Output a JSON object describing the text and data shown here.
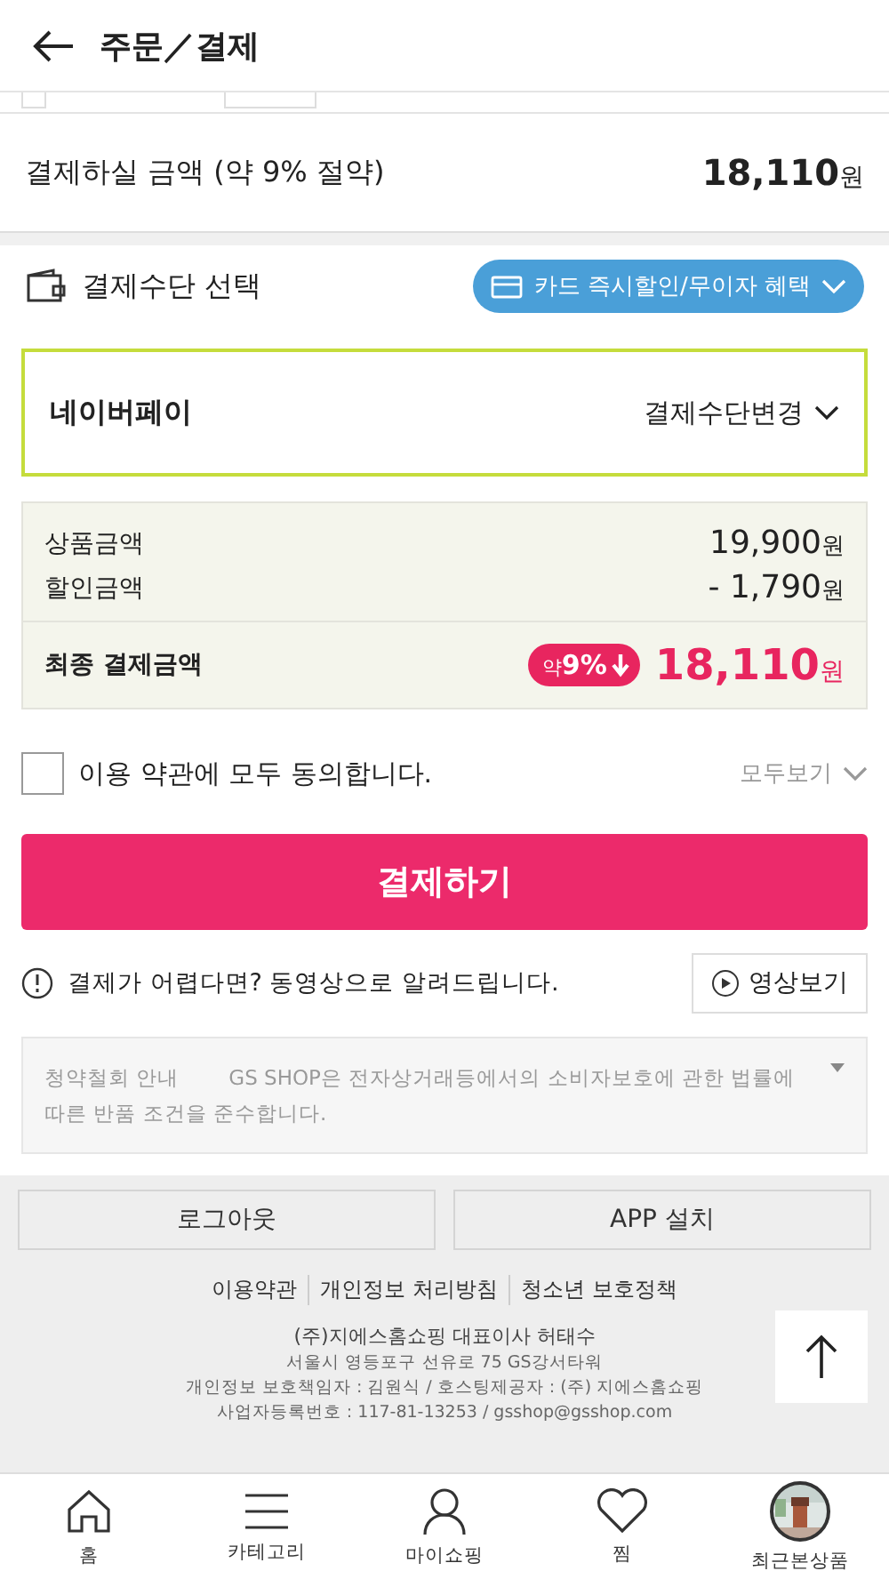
{
  "header": {
    "title": "주문／결제"
  },
  "payment_total": {
    "label": "결제하실 금액 (약 9% 절약)",
    "amount": "18,110",
    "unit": "원"
  },
  "payment_method": {
    "label": "결제수단 선택",
    "benefit_button": "카드 즉시할인/무이자 혜택",
    "selected_method": "네이버페이",
    "change_button": "결제수단변경"
  },
  "summary": {
    "rows": [
      {
        "label": "상품금액",
        "amount": "19,900",
        "unit": "원"
      },
      {
        "label": "할인금액",
        "amount": "- 1,790",
        "unit": "원"
      }
    ],
    "final": {
      "label": "최종 결제금액",
      "badge_prefix": "약",
      "badge_value": "9%",
      "amount": "18,110",
      "unit": "원"
    }
  },
  "agreement": {
    "label": "이용 약관에 모두 동의합니다.",
    "checked": false,
    "view_all": "모두보기"
  },
  "pay_button": "결제하기",
  "video_help": {
    "text": "결제가 어렵다면? 동영상으로 알려드립니다.",
    "button": "영상보기"
  },
  "notice": {
    "title": "청약철회 안내",
    "text": "GS SHOP은 전자상거래등에서의 소비자보호에 관한 법률에 따른 반품 조건을 준수합니다."
  },
  "footer": {
    "buttons": [
      "로그아웃",
      "APP 설치"
    ],
    "links": [
      "이용약관",
      "개인정보 처리방침",
      "청소년 보호정책"
    ],
    "company": "(주)지에스홈쇼핑 대표이사 허태수",
    "lines": [
      "서울시 영등포구 선유로 75 GS강서타워",
      "개인정보 보호책임자 : 김원식 / 호스팅제공자 : (주) 지에스홈쇼핑",
      "사업자등록번호 : 117-81-13253 / gsshop@gsshop.com"
    ]
  },
  "nav": [
    {
      "kind": "home",
      "label": "홈",
      "selected": false
    },
    {
      "kind": "category",
      "label": "카테고리",
      "selected": false
    },
    {
      "kind": "my",
      "label": "마이쇼핑",
      "selected": false
    },
    {
      "kind": "wish",
      "label": "찜",
      "selected": false
    },
    {
      "kind": "recent",
      "label": "최근본상품",
      "selected": false
    }
  ]
}
